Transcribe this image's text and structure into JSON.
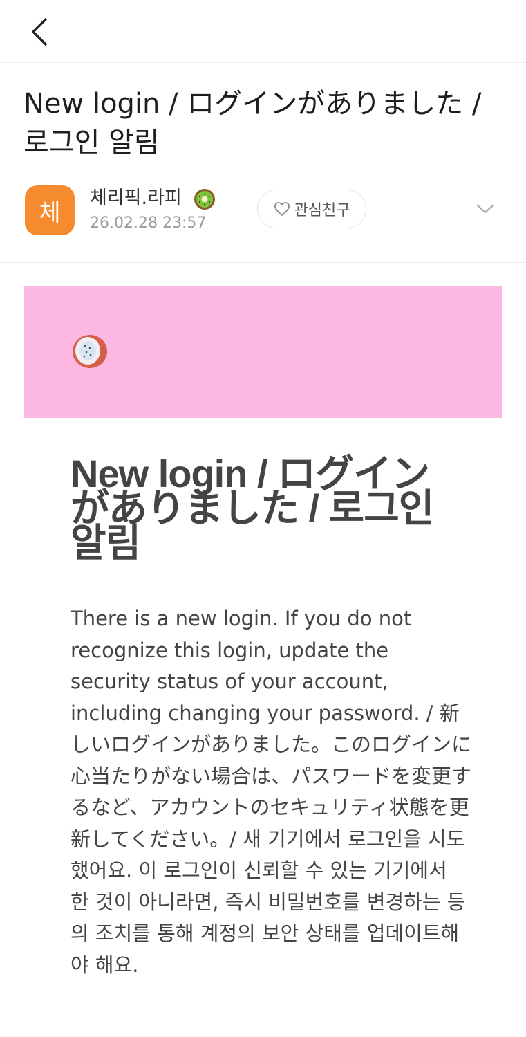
{
  "post": {
    "title": "New login / ログインがありました / 로그인 알림"
  },
  "author": {
    "avatar_letter": "체",
    "name": "체리픽.라피",
    "name_icon": "kiwi-icon",
    "date": "26.02.28 23:57",
    "follow_label": "관심친구"
  },
  "content": {
    "heading": "New login / ログインがありました / 로그인 알림",
    "body": "There is a new login. If you do not recognize this login, update the security status of your account, including changing your password. / 新しいログインがありました。このログインに心当たりがない場合は、パスワードを変更するなど、アカウントのセキュリティ状態を更新してください。/ 새 기기에서 로그인을 시도했어요. 이 로그인이 신뢰할 수 있는 기기에서 한 것이 아니라면, 즉시 비밀번호를 변경하는 등의 조치를 통해 계정의 보안 상태를 업데이트해야 해요."
  },
  "colors": {
    "avatar": "#f58a2e",
    "banner": "#fcb7e2"
  }
}
